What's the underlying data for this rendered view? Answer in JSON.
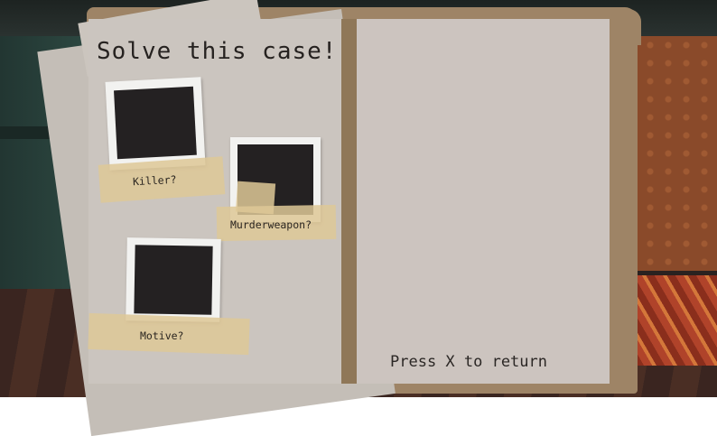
{
  "title": "Solve this case!",
  "clues": [
    {
      "label": "Killer?"
    },
    {
      "label": "Murderweapon?"
    },
    {
      "label": "Motive?"
    }
  ],
  "hint": "Press X to return",
  "colors": {
    "paper": "#cbc5bf",
    "folder": "#9e8466",
    "photo": "#242122",
    "tape": "#dec896"
  }
}
